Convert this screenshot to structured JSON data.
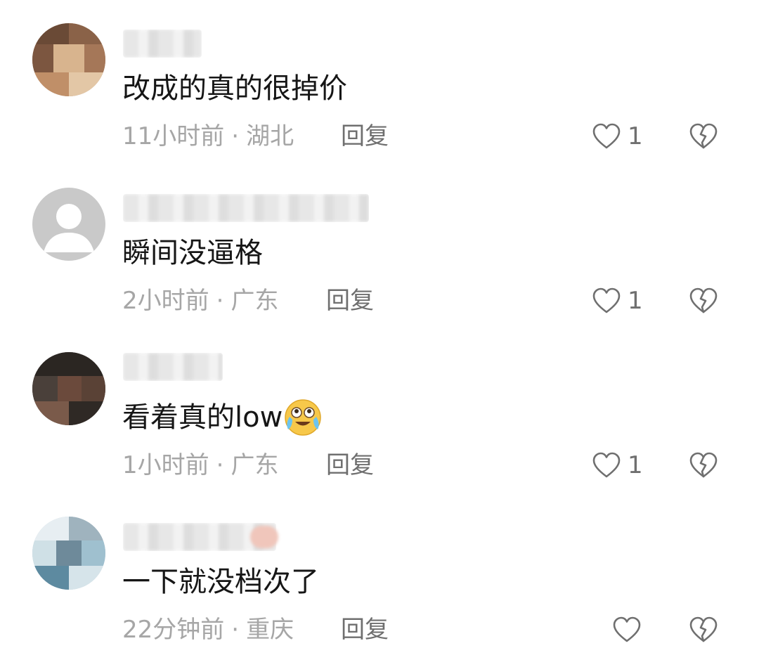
{
  "comments": [
    {
      "text": "改成的真的很掉价",
      "time": "11小时前",
      "separator": "·",
      "location": "湖北",
      "reply_label": "回复",
      "likes": "1",
      "avatar_colors": [
        "#6a4a36",
        "#c08f68",
        "#d8b48e"
      ]
    },
    {
      "text": "瞬间没逼格",
      "time": "2小时前",
      "separator": "·",
      "location": "广东",
      "reply_label": "回复",
      "likes": "1",
      "avatar_colors": [
        "#c9c9c9",
        "#ffffff",
        "#ffffff"
      ]
    },
    {
      "text": "看着真的low",
      "emoji": "crying-laughing-emoji",
      "time": "1小时前",
      "separator": "·",
      "location": "广东",
      "reply_label": "回复",
      "likes": "1",
      "avatar_colors": [
        "#2b2622",
        "#6b4a3c",
        "#4a403a"
      ]
    },
    {
      "text": "一下就没档次了",
      "time": "22分钟前",
      "separator": "·",
      "location": "重庆",
      "reply_label": "回复",
      "likes": "",
      "avatar_colors": [
        "#9fc0cf",
        "#6e8a9a",
        "#cfe0e6"
      ]
    }
  ],
  "icons": {
    "like": "heart-outline-icon",
    "dislike": "broken-heart-icon"
  },
  "colors": {
    "primary_text": "#161616",
    "meta_text": "#a6a6a6",
    "action_text": "#6f6f6f"
  }
}
